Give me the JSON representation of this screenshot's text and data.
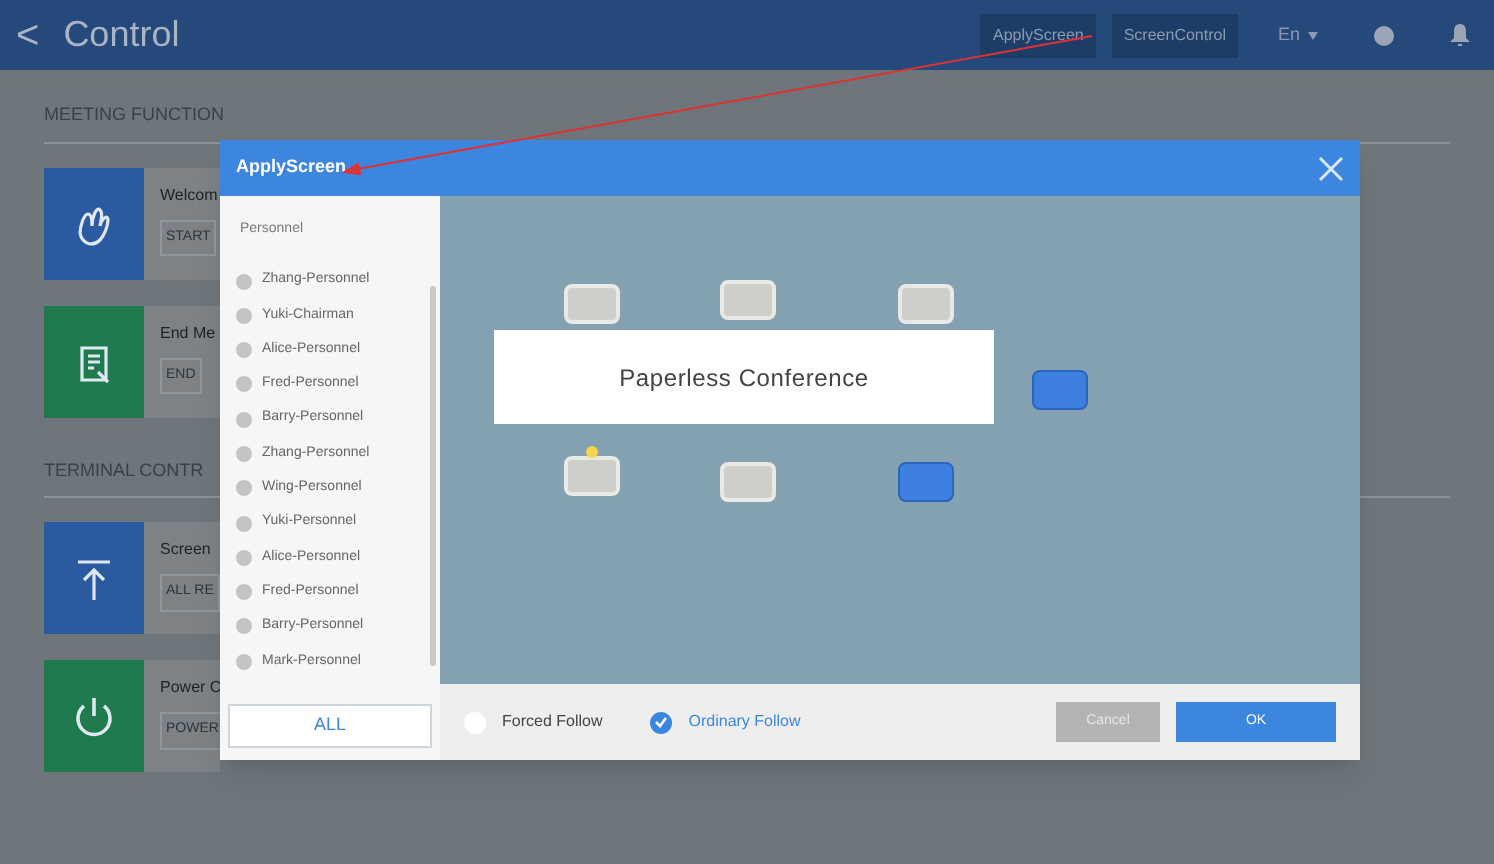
{
  "header": {
    "back": "<",
    "title": "Control",
    "buttons": [
      "ApplyScreen",
      "ScreenControl"
    ],
    "language": "En"
  },
  "sections": [
    {
      "title": "MEETING FUNCTION",
      "cards": [
        {
          "kind": "wave",
          "color": "#2c5aa0",
          "label": "Welcom",
          "action": "START"
        },
        {
          "kind": "end",
          "color": "#1f7a4d",
          "label": "End Me",
          "action": "END"
        }
      ]
    },
    {
      "title": "TERMINAL CONTR",
      "cards": [
        {
          "kind": "upload",
          "color": "#2c5aa0",
          "label": "Screen",
          "action": "ALL RE"
        },
        {
          "kind": "power",
          "color": "#1f7a4d",
          "label": "Power C",
          "action": "POWER"
        }
      ]
    }
  ],
  "dialog": {
    "title": "ApplyScreen",
    "list_heading": "Personnel",
    "personnel": [
      {
        "name": "Zhang-Personnel",
        "selected": false
      },
      {
        "name": "Yuki-Chairman",
        "selected": false
      },
      {
        "name": "Alice-Personnel",
        "selected": false
      },
      {
        "name": "Fred-Personnel",
        "selected": false
      },
      {
        "name": "Barry-Personnel",
        "selected": false
      },
      {
        "name": "Zhang-Personnel",
        "selected": false
      },
      {
        "name": "Wing-Personnel",
        "selected": false
      },
      {
        "name": "Yuki-Personnel",
        "selected": false
      },
      {
        "name": "Alice-Personnel",
        "selected": false
      },
      {
        "name": "Fred-Personnel",
        "selected": false
      },
      {
        "name": "Barry-Personnel",
        "selected": false
      },
      {
        "name": "Mark-Personnel",
        "selected": false
      }
    ],
    "all_button": "ALL",
    "table_label": "Paperless Conference",
    "seats": [
      {
        "selected": false,
        "chairman": false
      },
      {
        "selected": false,
        "chairman": false
      },
      {
        "selected": false,
        "chairman": false
      },
      {
        "selected": true,
        "chairman": false
      },
      {
        "selected": false,
        "chairman": true
      },
      {
        "selected": false,
        "chairman": false
      },
      {
        "selected": true,
        "chairman": false
      }
    ],
    "follow_options": [
      {
        "label": "Forced Follow",
        "selected": false
      },
      {
        "label": "Ordinary Follow",
        "selected": true
      }
    ],
    "cancel": "Cancel",
    "ok": "OK"
  }
}
